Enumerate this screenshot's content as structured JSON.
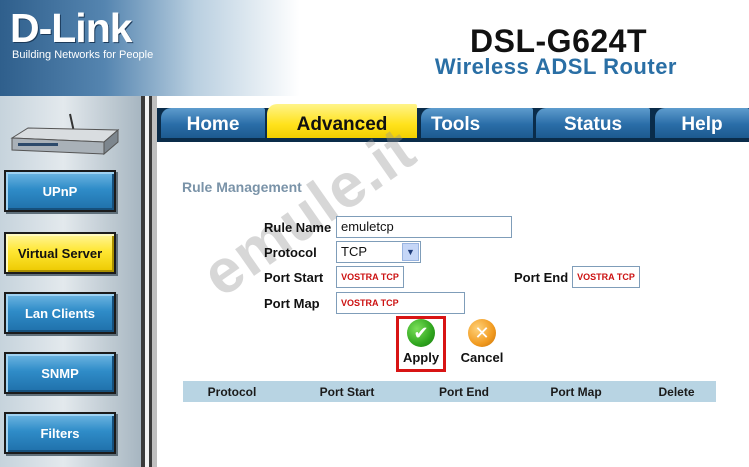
{
  "header": {
    "brand": "D-Link",
    "tagline": "Building Networks for People",
    "model": "DSL-G624T",
    "product": "Wireless ADSL Router"
  },
  "nav": {
    "items": [
      {
        "label": "UPnP",
        "active": false
      },
      {
        "label": "Virtual Server",
        "active": true
      },
      {
        "label": "Lan Clients",
        "active": false
      },
      {
        "label": "SNMP",
        "active": false
      },
      {
        "label": "Filters",
        "active": false
      }
    ]
  },
  "tabs": [
    {
      "label": "Home",
      "active": false
    },
    {
      "label": "Advanced",
      "active": true
    },
    {
      "label": "Tools",
      "active": false
    },
    {
      "label": "Status",
      "active": false
    },
    {
      "label": "Help",
      "active": false
    }
  ],
  "form": {
    "section_title": "Rule Management",
    "rule_name_label": "Rule Name",
    "rule_name_value": "emuletcp",
    "protocol_label": "Protocol",
    "protocol_value": "TCP",
    "port_start_label": "Port Start",
    "port_start_value": "VOSTRA TCP",
    "port_end_label": "Port End",
    "port_end_value": "VOSTRA TCP",
    "port_map_label": "Port Map",
    "port_map_value": "VOSTRA TCP",
    "apply_label": "Apply",
    "cancel_label": "Cancel"
  },
  "table": {
    "columns": [
      "Protocol",
      "Port Start",
      "Port End",
      "Port Map",
      "Delete"
    ]
  },
  "watermark": "emule.it",
  "colors": {
    "tab_active": "#ffe21c",
    "tab_inactive": "#2a6da8",
    "nav_button": "#2f8cc8",
    "nav_button_active": "#ffe733",
    "section_title": "#7a93a8",
    "apply_highlight": "#d81414",
    "table_header": "#b8d4e3",
    "field_value_red": "#cc1111"
  },
  "icons": {
    "apply": "check-circle-green",
    "cancel": "x-circle-orange",
    "router": "router-device"
  }
}
